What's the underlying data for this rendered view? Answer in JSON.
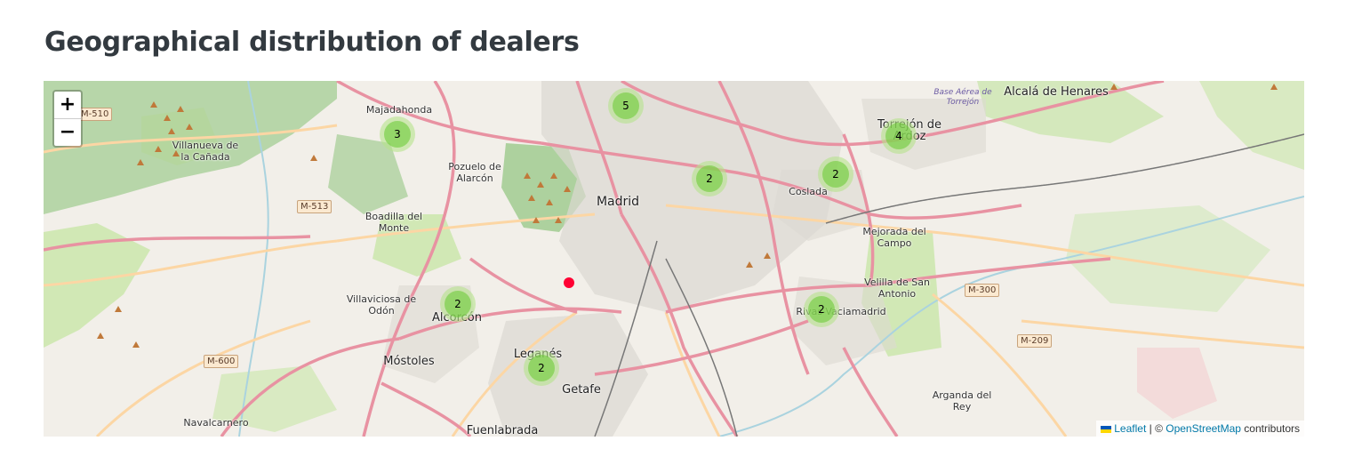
{
  "page": {
    "title": "Geographical distribution of dealers"
  },
  "map": {
    "zoom_in_label": "+",
    "zoom_out_label": "−",
    "clusters": [
      {
        "count": "5"
      },
      {
        "count": "3"
      },
      {
        "count": "2"
      },
      {
        "count": "2"
      },
      {
        "count": "4"
      },
      {
        "count": "2"
      },
      {
        "count": "2"
      },
      {
        "count": "2"
      }
    ],
    "places": {
      "madrid": "Madrid",
      "majadahonda": "Majadahonda",
      "villanueva": "Villanueva de la Cañada",
      "pozuelo": "Pozuelo de Alarcón",
      "boadilla": "Boadilla del Monte",
      "villaviciosa": "Villaviciosa de Odón",
      "alcorcon": "Alcorcón",
      "mostoles": "Móstoles",
      "leganes": "Leganés",
      "getafe": "Getafe",
      "fuenlabrada": "Fuenlabrada",
      "navalcarnero": "Navalcarnero",
      "coslada": "Coslada",
      "torrejon": "Torrejón de Ardoz",
      "alcala": "Alcalá de Henares",
      "mejorada": "Mejorada del Campo",
      "velilla": "Velilla de San Antonio",
      "rivas": "Rivas-Vaciamadrid",
      "arganda": "Arganda del Rey",
      "base": "Base Aérea de Torrejón"
    },
    "road_shields": {
      "m510": "M-510",
      "m513": "M-513",
      "m600": "M-600",
      "m300": "M-300",
      "m209": "M-209"
    },
    "attribution": {
      "leaflet": "Leaflet",
      "separator": " | © ",
      "osm": "OpenStreetMap",
      "suffix": " contributors"
    },
    "colors": {
      "land": "#f2efe9",
      "park": "#c8e6a8",
      "forest": "#add19e",
      "motorway": "#e892a2",
      "primary": "#fcd6a4",
      "urban": "#dcd8d2",
      "cluster_outer": "#b5e28c",
      "cluster_inner": "#6ecc39",
      "marker": "#ff0033"
    }
  }
}
